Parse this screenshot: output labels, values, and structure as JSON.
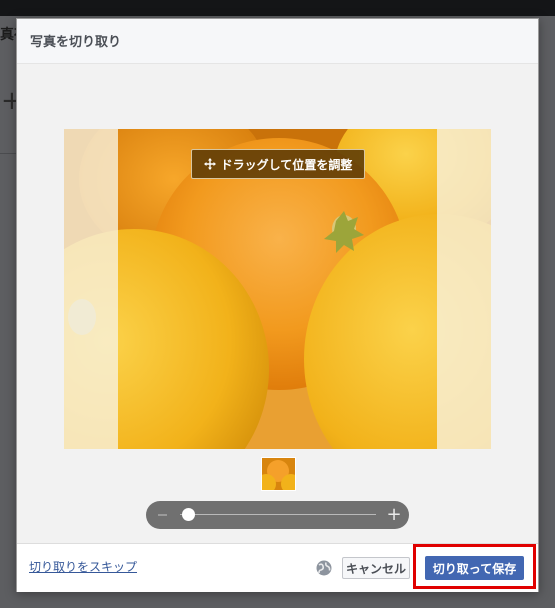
{
  "background": {
    "title_fragment": "真存",
    "plus_glyph": "+"
  },
  "modal": {
    "title": "写真を切り取り",
    "drag_hint": "ドラッグして位置を調整",
    "zoom": {
      "level": 0.05
    },
    "footer": {
      "skip_label": "切り取りをスキップ",
      "cancel_label": "キャンセル",
      "save_label": "切り取って保存"
    }
  },
  "colors": {
    "primary_button": "#4267b2",
    "link": "#365899",
    "highlight": "#e00000"
  },
  "icons": [
    "move-icon",
    "globe-icon",
    "zoom-plus-icon",
    "zoom-minus-icon"
  ]
}
